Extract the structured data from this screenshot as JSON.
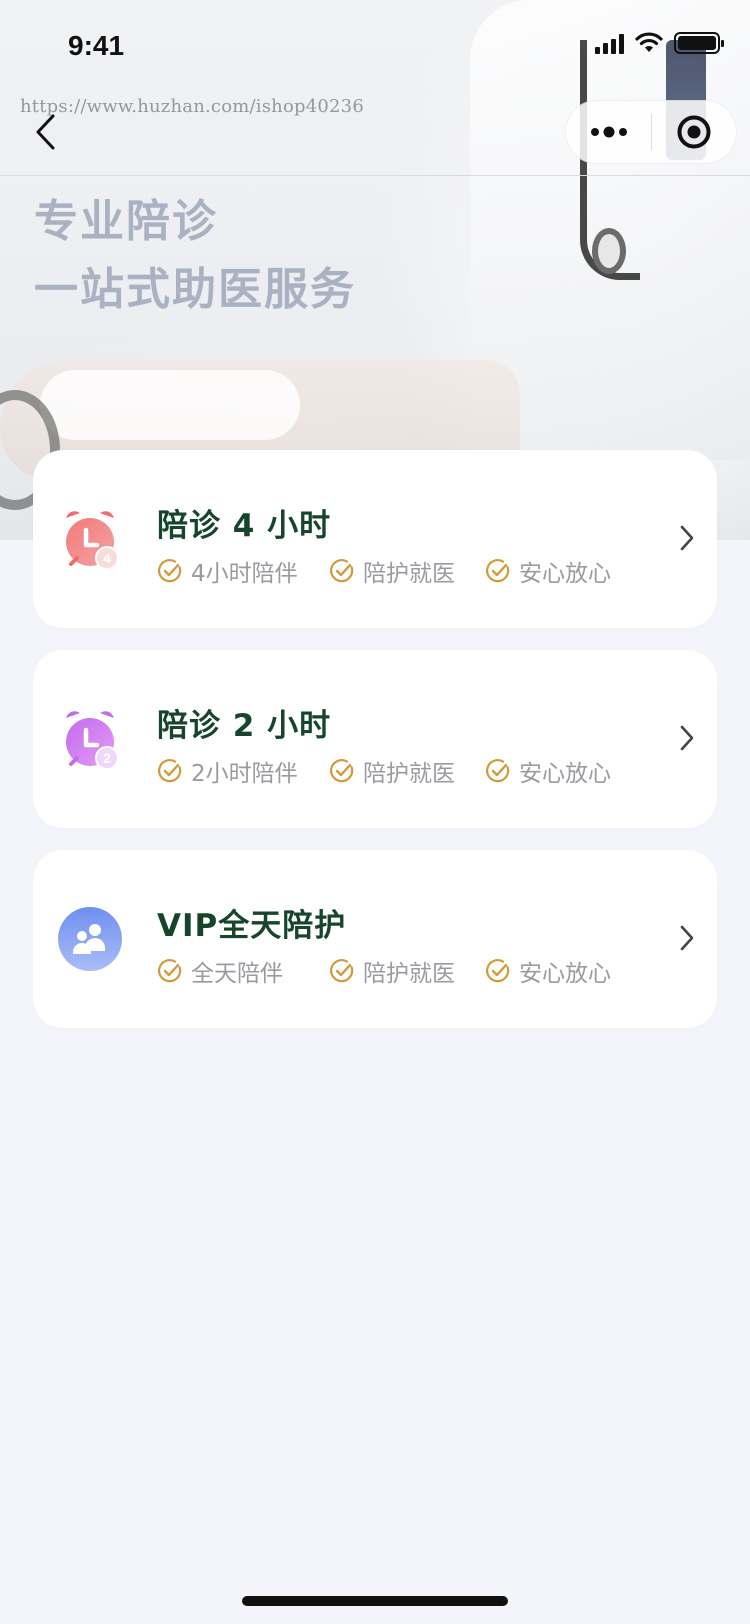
{
  "status_bar": {
    "time": "9:41"
  },
  "watermark": "https://www.huzhan.com/ishop40236",
  "hero": {
    "title_line1": "专业陪诊",
    "title_line2": "一站式助医服务"
  },
  "services": [
    {
      "title": "陪诊 4 小时",
      "icon": "alarm-clock-icon",
      "icon_badge": "4",
      "icon_color": "#f26b6b",
      "features": [
        "4小时陪伴",
        "陪护就医",
        "安心放心"
      ]
    },
    {
      "title": "陪诊 2 小时",
      "icon": "alarm-clock-icon",
      "icon_badge": "2",
      "icon_color": "#c36cf0",
      "features": [
        "2小时陪伴",
        "陪护就医",
        "安心放心"
      ]
    },
    {
      "title": "VIP全天陪护",
      "icon": "people-group-icon",
      "icon_color": "#6f8ff0",
      "features": [
        "全天陪伴",
        "陪护就医",
        "安心放心"
      ]
    }
  ],
  "colors": {
    "background": "#f4f5fa",
    "card": "#ffffff",
    "title_green": "#16452c",
    "check_gold": "#d29a3c",
    "feature_gray": "#9a9ba0",
    "hero_text": "#aab2c2"
  }
}
